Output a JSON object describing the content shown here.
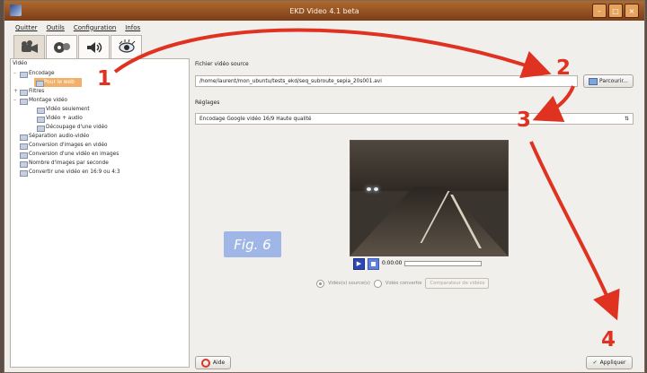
{
  "window": {
    "title": "EKD Video 4.1 beta"
  },
  "window_controls": [
    "–",
    "□",
    "×"
  ],
  "menu": [
    "Quitter",
    "Outils",
    "Configuration",
    "Infos"
  ],
  "toolbar": {
    "tabs": [
      "video-tab",
      "film-reel-tab",
      "audio-tab",
      "image-tab"
    ]
  },
  "sidebar": {
    "title": "Vidéo",
    "items": [
      {
        "label": "Encodage",
        "level": 0,
        "toggle": "–"
      },
      {
        "label": "Pour le web",
        "level": 1,
        "selected": true
      },
      {
        "label": "Filtres",
        "level": 0,
        "toggle": "+"
      },
      {
        "label": "Montage vidéo",
        "level": 0,
        "toggle": "–"
      },
      {
        "label": "Vidéo seulement",
        "level": 1
      },
      {
        "label": "Vidéo + audio",
        "level": 1
      },
      {
        "label": "Découpage d'une vidéo",
        "level": 1
      },
      {
        "label": "Séparation audio-vidéo",
        "level": 0
      },
      {
        "label": "Conversion d'images en vidéo",
        "level": 0
      },
      {
        "label": "Conversion d'une vidéo en images",
        "level": 0
      },
      {
        "label": "Nombre d'images par seconde",
        "level": 0
      },
      {
        "label": "Convertir une vidéo en 16:9 ou 4:3",
        "level": 0
      }
    ]
  },
  "main": {
    "source_label": "Fichier vidéo source",
    "source_value": "/home/laurent/mon_ubuntu/tests_ekd/seq_subroute_sepia_20s001.avi",
    "browse_label": "Parcourir...",
    "settings_label": "Réglages",
    "settings_value": "Encodage Google vidéo 16/9 Haute qualité",
    "time": "0:00:00",
    "radio_source": "Vidéo(s) source(s)",
    "radio_converted": "Vidéo convertie",
    "compare_label": "Comparateur de vidéos",
    "fig_label": "Fig. 6",
    "help_label": "Aide",
    "apply_label": "Appliquer"
  },
  "annotations": [
    "1",
    "2",
    "3",
    "4"
  ],
  "colors": {
    "accent": "#e03221",
    "selection": "#f2b16a",
    "fig_bg": "#9fb6e6"
  }
}
